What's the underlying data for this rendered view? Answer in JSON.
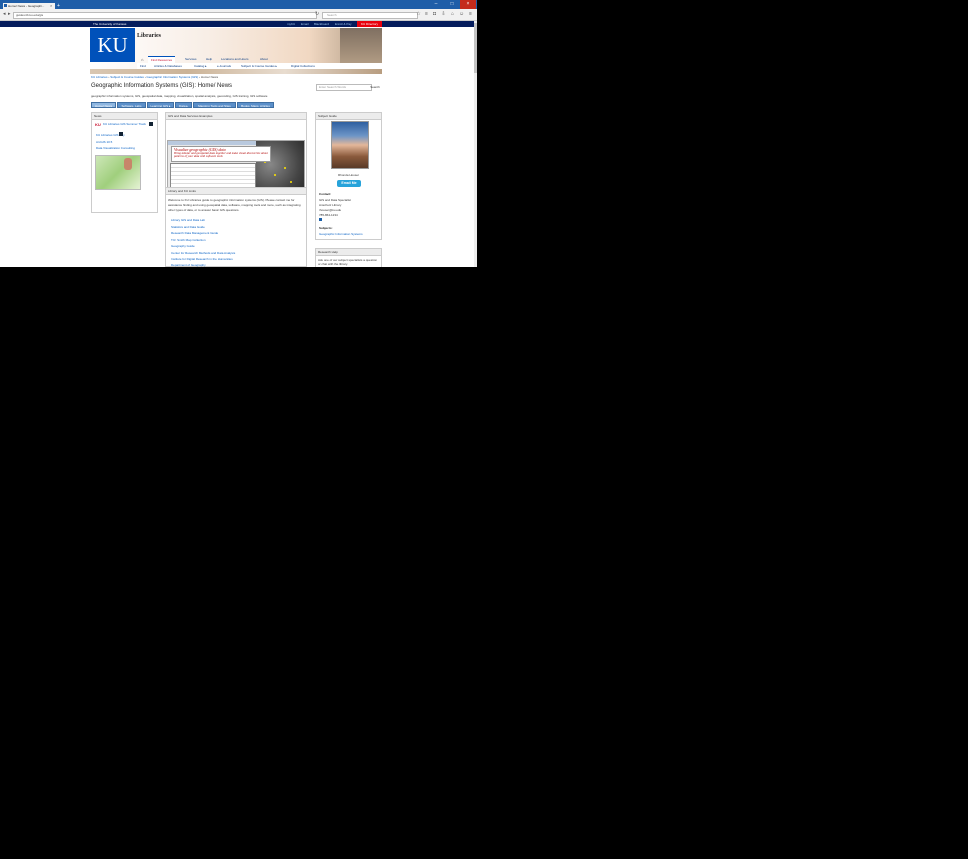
{
  "browser": {
    "tab_title": "Home/ News - Geographi...",
    "tab_close": "×",
    "new_tab": "+",
    "url": "guides.lib.ku.edu/gis",
    "search_placeholder": "Search"
  },
  "site": {
    "university_name": "The University of Kansas",
    "top_links": [
      "myKU",
      "Email",
      "Blackboard",
      "Enroll & Pay"
    ],
    "ku_directory": "KU Directory",
    "logo_text": "KU",
    "libraries_title": "Libraries",
    "main_nav": [
      "Find Resources",
      "Services",
      "Help",
      "Locations and Hours",
      "About"
    ],
    "sub_nav": [
      "Find",
      "Articles & Databases",
      "Catalog ▸",
      "e-Journals",
      "Subject & Course Guides ▸",
      "Digital Collections"
    ]
  },
  "breadcrumb": [
    "KU Libraries",
    "Subject & Course Guides",
    "Geographic Information Systems (GIS)",
    "Home/ News"
  ],
  "page": {
    "title": "Geographic Information Systems (GIS): Home/ News",
    "search_placeholder": "Enter Search Words",
    "search_button": "Search",
    "description": "geographic information systems, GIS, geospatial data, mapping, visualization, spatial analysis, geocoding, GIS training, GIS software"
  },
  "guide_tabs": [
    "Home/ News",
    "Software, Labs",
    "Learning GIS ▸",
    "Data ▸",
    "Mapping Tools and Sites",
    "Books, Maps, Articles"
  ],
  "news_box": {
    "title": "News",
    "items": [
      "KU Libraries GIS Summer Track",
      "KU Libraries GIS Day",
      "ArcGIS 10.5",
      "Data Visualization Consulting"
    ]
  },
  "examples_box": {
    "title": "GIS and Data Services Examples",
    "callout_title": "Visualize geographic (GIS) data",
    "callout_text": "Bring tabular and geospatial data together and make visual discoveries about patterns of your data with software tools"
  },
  "library_box": {
    "title": "Library and KU Links",
    "intro": "Welcome to KU Libraries guide to geographic information systems (GIS). Please contact me for assistance finding and using geospatial data, software, mapping tools and more, such as integrating other types of data, or to answer basic GIS questions.",
    "links": [
      "Library GIS and Data Lab",
      "Statistics and Data Guide",
      "Research Data Management Guide",
      "T.R. Smith Map Collection",
      "Geography Guide",
      "Center for Research Methods and Data Analysis",
      "Institute for Digital Research in the Humanities",
      "Department of Geography"
    ]
  },
  "subject_guide": {
    "title": "Subject Guide",
    "name": "Rhonda Houser",
    "email_button": "Email Me",
    "contact_label": "Contact:",
    "contact_lines": [
      "GIS and Data Specialist",
      "Anschutz Library",
      "rhouser@ku.edu",
      "785-864-1234"
    ],
    "subjects_label": "Subjects:",
    "subjects_value": "Geographic Information Systems"
  },
  "research_box": {
    "title": "Research Help",
    "text": "Ask one of our subject specialists a question or chat with the library."
  }
}
